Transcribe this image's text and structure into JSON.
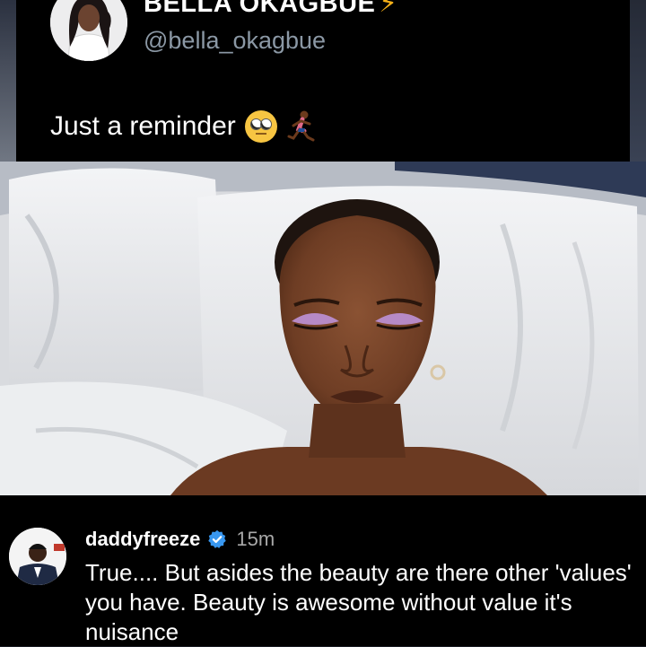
{
  "tweet": {
    "display_name": "BELLA OKAGBUE",
    "badge_icon": "lightning-bolt-icon",
    "handle": "@bella_okagbue",
    "text": "Just a reminder",
    "emojis": [
      "face-with-rolling-eyes-emoji",
      "running-woman-emoji"
    ]
  },
  "photo": {
    "icon": "woman-on-pillow-photo"
  },
  "comment": {
    "username": "daddyfreeze",
    "verified_icon": "verified-badge-icon",
    "time": "15m",
    "text": "True.... But asides the beauty are there other 'values' you have. Beauty is awesome without value it's nuisance"
  },
  "colors": {
    "background": "#000000",
    "handle_gray": "#8b98a5",
    "verified_blue": "#3897f0",
    "bolt_yellow": "#f5b018"
  }
}
